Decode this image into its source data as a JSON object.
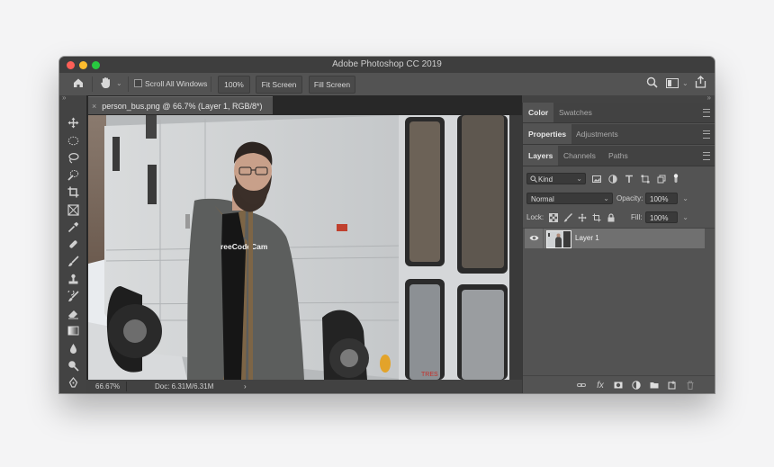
{
  "window": {
    "title": "Adobe Photoshop CC 2019"
  },
  "options_bar": {
    "home_icon": "home-icon",
    "hand_icon": "hand-icon",
    "scroll_all_windows_label": "Scroll All Windows",
    "zoom_value": "100%",
    "fit_screen_label": "Fit Screen",
    "fill_screen_label": "Fill Screen"
  },
  "document": {
    "tab_title": "person_bus.png @ 66.7% (Layer 1, RGB/8*)",
    "zoom": "66.67%",
    "doc_size": "Doc: 6.31M/6.31M",
    "status_arrow": "›"
  },
  "image_text": {
    "shirt_text": "reeCodeCam",
    "sign_text": "TRES"
  },
  "panels": {
    "top_tabs": [
      "Color",
      "Swatches"
    ],
    "mid_tabs": [
      "Properties",
      "Adjustments"
    ],
    "layer_tabs": [
      "Layers",
      "Channels",
      "Paths"
    ],
    "filter_kind": "Kind",
    "blend_mode": "Normal",
    "opacity_label": "Opacity:",
    "opacity_value": "100%",
    "lock_label": "Lock:",
    "fill_label": "Fill:",
    "fill_value": "100%",
    "layers": [
      {
        "name": "Layer 1",
        "visible": true
      }
    ]
  },
  "colors": {
    "ui_dark": "#535353",
    "ui_darker": "#424242",
    "selected_layer": "#707070",
    "red": "#fd5f57",
    "yellow": "#febc2e",
    "green": "#28c840"
  }
}
